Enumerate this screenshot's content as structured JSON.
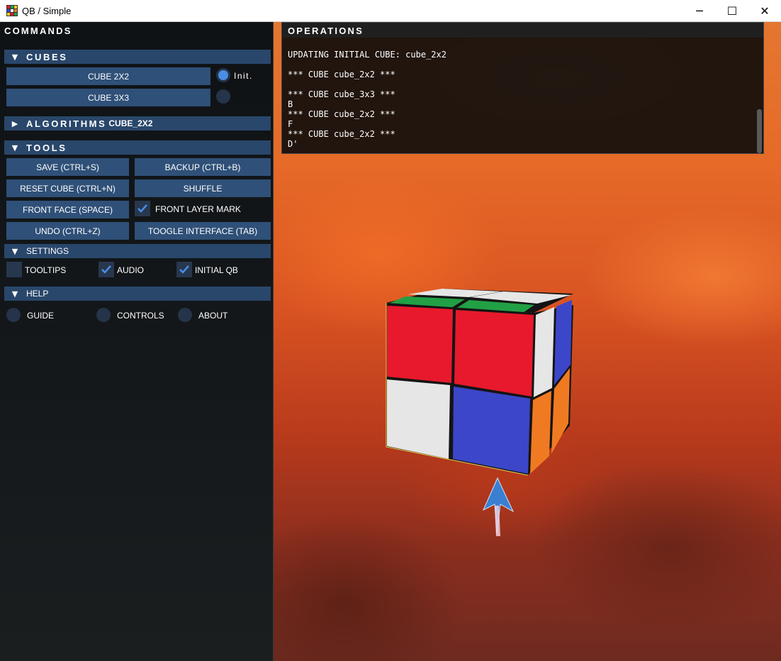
{
  "window": {
    "title": "QB / Simple",
    "icon": "rubik-cube-app-icon",
    "controls": {
      "minimize": "─",
      "maximize": "☐",
      "close": "✕"
    }
  },
  "commands": {
    "title": "COMMANDS",
    "cubes": {
      "header": "CUBES",
      "buttons": [
        "CUBE 2X2",
        "CUBE 3X3"
      ],
      "init_label": "Init.",
      "selected": "CUBE 2X2"
    },
    "algorithms": {
      "header_prefix": "ALGORITHMS",
      "header_suffix": "CUBE_2X2",
      "expanded": false
    },
    "tools": {
      "header": "TOOLS",
      "save": "SAVE (CTRL+S)",
      "backup": "BACKUP (CTRL+B)",
      "reset": "RESET CUBE (CTRL+N)",
      "shuffle": "SHUFFLE",
      "front_face": "FRONT FACE (SPACE)",
      "front_layer_mark": "FRONT LAYER MARK",
      "front_layer_mark_checked": true,
      "undo": "UNDO (CTRL+Z)",
      "toggle_interface": "TOOGLE INTERFACE (TAB)"
    },
    "settings": {
      "header": "SETTINGS",
      "tooltips": "TOOLTIPS",
      "tooltips_checked": false,
      "audio": "AUDIO",
      "audio_checked": true,
      "initial_qb": "INITIAL QB",
      "initial_qb_checked": true
    },
    "help": {
      "header": "HELP",
      "guide": "GUIDE",
      "controls": "CONTROLS",
      "about": "ABOUT"
    }
  },
  "operations": {
    "title": "OPERATIONS",
    "log": [
      "UPDATING INITIAL CUBE: cube_2x2",
      "*** CUBE cube_2x2 ***",
      "*** CUBE cube_3x3 ***",
      "B",
      "*** CUBE cube_2x2 ***",
      "F",
      "*** CUBE cube_2x2 ***",
      "D'"
    ]
  },
  "cube": {
    "colors": {
      "red": "#e8192c",
      "white": "#e6e6e6",
      "blue": "#3c46c8",
      "green": "#22a045",
      "orange": "#f07a22",
      "black": "#141414"
    }
  },
  "colors": {
    "panel_header": "#29476b",
    "button": "#2f5078",
    "radio_active": "#4a8de6"
  }
}
